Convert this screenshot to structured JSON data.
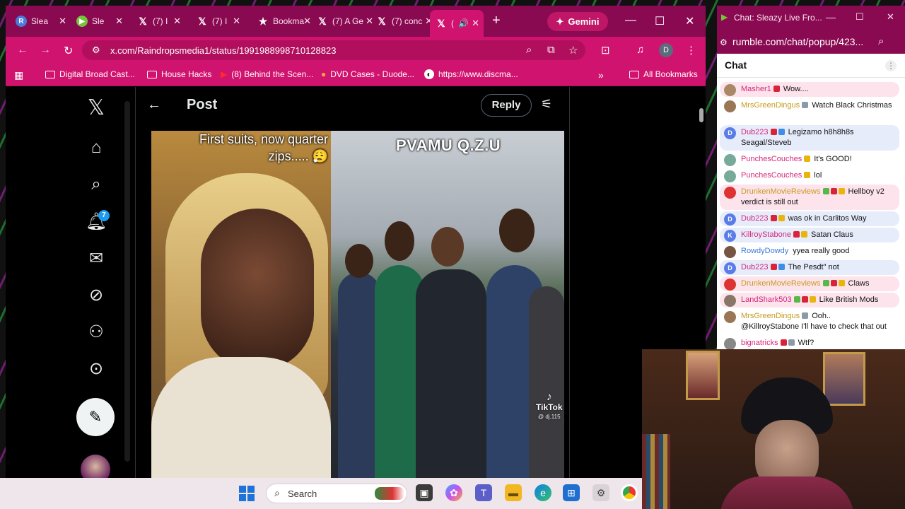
{
  "browser": {
    "tabs": [
      {
        "label": "Slea",
        "icon": "rumble-R-icon"
      },
      {
        "label": "Sle",
        "icon": "rumble-play-icon"
      },
      {
        "label": "(7) I",
        "icon": "x-logo-icon"
      },
      {
        "label": "(7) I",
        "icon": "x-logo-icon"
      },
      {
        "label": "Bookma",
        "icon": "star-icon"
      },
      {
        "label": "(7) A Ge",
        "icon": "x-logo-icon"
      },
      {
        "label": "(7) conc",
        "icon": "x-logo-icon"
      },
      {
        "label": "(",
        "icon": "x-logo-icon",
        "active": true
      }
    ],
    "new_tab": "+",
    "gemini_label": "Gemini",
    "url": "x.com/Raindropsmedia1/status/1991988998710128823",
    "profile_initial": "D",
    "bookmarks": [
      {
        "label": "Digital Broad Cast...",
        "icon": "folder-icon"
      },
      {
        "label": "House Hacks",
        "icon": "folder-icon"
      },
      {
        "label": "(8) Behind the Scen...",
        "icon": "youtube-icon"
      },
      {
        "label": "DVD Cases - Duode...",
        "icon": "site-icon"
      },
      {
        "label": "https://www.discma...",
        "icon": "site-icon"
      }
    ],
    "all_bookmarks": "All Bookmarks",
    "accent": "#d0136e",
    "tabbar_color": "#8a0a52"
  },
  "x": {
    "notification_count": "7",
    "header_title": "Post",
    "reply_label": "Reply",
    "video": {
      "caption_left": "First suits, now quarter zips..... 😮‍💨",
      "title_right": "PVAMU Q.Z.U",
      "watermark": "TikTok",
      "watermark_handle": "@ dj.115"
    }
  },
  "taskbar": {
    "search_placeholder": "Search"
  },
  "chat": {
    "window_title": "Chat: Sleazy Live Fro...",
    "url": "rumble.com/chat/popup/423...",
    "header": "Chat",
    "messages": [
      {
        "user": "Masher1",
        "user_color": "#d6267a",
        "text": "Wow....",
        "bg": "pink",
        "badges": [
          "red"
        ],
        "av": "#a86"
      },
      {
        "user": "MrsGreenDingus",
        "user_color": "#c79a1c",
        "text": "Watch Black Christmas",
        "bg": "none",
        "badges": [
          "gry"
        ],
        "av": "#975"
      },
      {
        "user": "Dub223",
        "user_color": "#d6267a",
        "text": "Legizamo h8h8h8s Seagal/Steveb",
        "bg": "blue",
        "badges": [
          "red",
          "blu"
        ],
        "av": "#5a7ce8",
        "initial": "D"
      },
      {
        "user": "PunchesCouches",
        "user_color": "#d6267a",
        "text": "It's GOOD!",
        "bg": "none",
        "badges": [
          "yel"
        ],
        "av": "#7a9"
      },
      {
        "user": "PunchesCouches",
        "user_color": "#d6267a",
        "text": "lol",
        "bg": "none",
        "badges": [
          "yel"
        ],
        "av": "#7a9"
      },
      {
        "user": "DrunkenMovieReviews",
        "user_color": "#c79a1c",
        "text": "Hellboy v2 verdict is still out",
        "bg": "pink",
        "badges": [
          "grn",
          "red",
          "yel"
        ],
        "av": "#d33"
      },
      {
        "user": "Dub223",
        "user_color": "#d6267a",
        "text": "was ok in Carlitos Way",
        "bg": "blue",
        "badges": [
          "red",
          "yel"
        ],
        "av": "#5a7ce8",
        "initial": "D"
      },
      {
        "user": "KillroyStabone",
        "user_color": "#d6267a",
        "text": "Satan Claus",
        "bg": "blue",
        "badges": [
          "red",
          "yel"
        ],
        "av": "#5a7ce8",
        "initial": "K"
      },
      {
        "user": "RowdyDowdy",
        "user_color": "#3b78d8",
        "text": "yyea really good",
        "bg": "none",
        "badges": [],
        "av": "#754"
      },
      {
        "user": "Dub223",
        "user_color": "#d6267a",
        "text": "The Pesdt\" not",
        "bg": "blue",
        "badges": [
          "red",
          "blu"
        ],
        "av": "#5a7ce8",
        "initial": "D"
      },
      {
        "user": "DrunkenMovieReviews",
        "user_color": "#c79a1c",
        "text": "Claws",
        "bg": "pink",
        "badges": [
          "grn",
          "red",
          "yel"
        ],
        "av": "#d33"
      },
      {
        "user": "LandShark503",
        "user_color": "#d6267a",
        "text": "Like British Mods",
        "bg": "pink",
        "badges": [
          "grn",
          "red",
          "yel"
        ],
        "av": "#876"
      },
      {
        "user": "MrsGreenDingus",
        "user_color": "#c79a1c",
        "text": "Ooh..",
        "text2": "@KillroyStabone I'll have to check that out",
        "bg": "none",
        "badges": [
          "gry"
        ],
        "av": "#975"
      },
      {
        "user": "bignatricks",
        "user_color": "#d6267a",
        "text": "Wtf?",
        "bg": "none",
        "badges": [
          "red",
          "gry"
        ],
        "av": "#888"
      }
    ]
  }
}
